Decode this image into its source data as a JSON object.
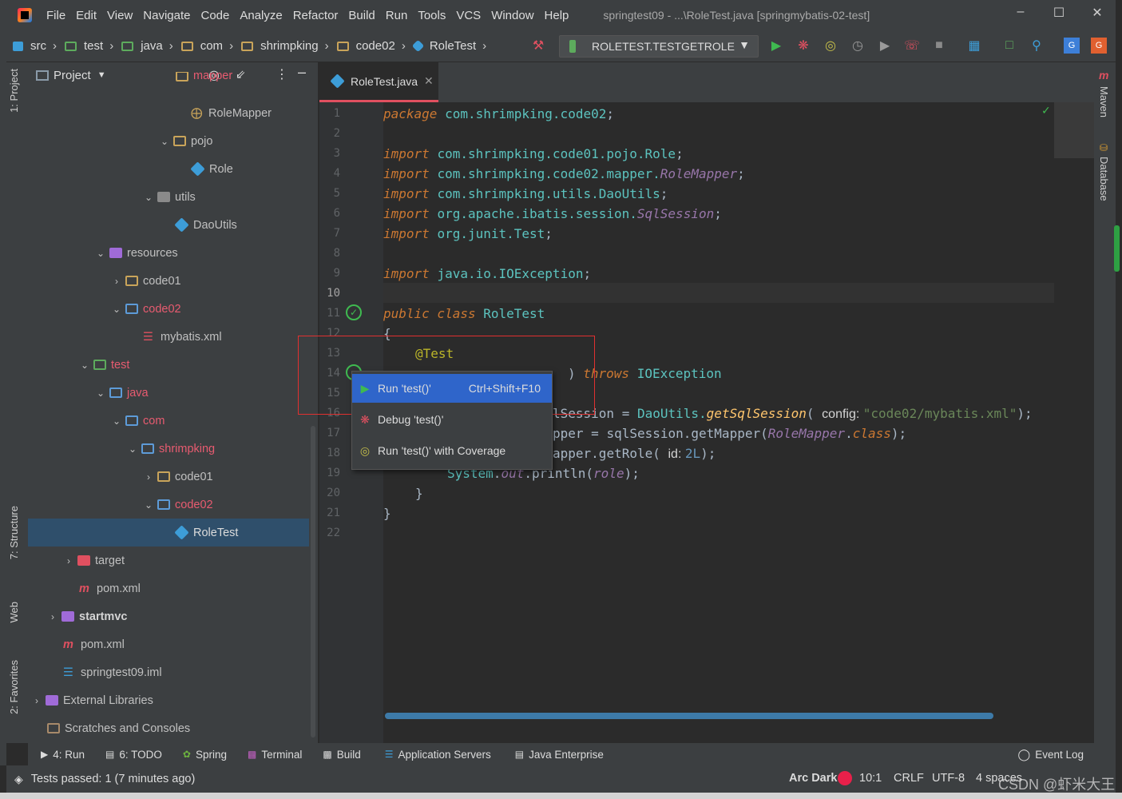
{
  "titlebar": {
    "menus": [
      "File",
      "Edit",
      "View",
      "Navigate",
      "Code",
      "Analyze",
      "Refactor",
      "Build",
      "Run",
      "Tools",
      "VCS",
      "Window",
      "Help"
    ],
    "title": "springtest09 - ...\\RoleTest.java [springmybatis-02-test]"
  },
  "breadcrumbs": [
    "src",
    "test",
    "java",
    "com",
    "shrimpking",
    "code02",
    "RoleTest"
  ],
  "run_config": "ROLETEST.TESTGETROLE",
  "project_panel": {
    "title": "Project",
    "items": [
      {
        "label": "mapper"
      },
      {
        "label": "RoleMapper"
      },
      {
        "label": "pojo"
      },
      {
        "label": "Role"
      },
      {
        "label": "utils"
      },
      {
        "label": "DaoUtils"
      },
      {
        "label": "resources"
      },
      {
        "label": "code01"
      },
      {
        "label": "code02"
      },
      {
        "label": "mybatis.xml"
      },
      {
        "label": "test"
      },
      {
        "label": "java"
      },
      {
        "label": "com"
      },
      {
        "label": "shrimpking"
      },
      {
        "label": "code01"
      },
      {
        "label": "code02"
      },
      {
        "label": "RoleTest"
      },
      {
        "label": "target"
      },
      {
        "label": "pom.xml"
      },
      {
        "label": "startmvc"
      },
      {
        "label": "pom.xml"
      },
      {
        "label": "springtest09.iml"
      },
      {
        "label": "External Libraries"
      },
      {
        "label": "Scratches and Consoles"
      }
    ]
  },
  "left_strip": {
    "project": "1: Project",
    "structure": "7: Structure",
    "web": "Web",
    "favorites": "2: Favorites"
  },
  "right_strip": {
    "maven": "Maven",
    "database": "Database"
  },
  "editor": {
    "tab": "RoleTest.java",
    "line_numbers": [
      "1",
      "2",
      "3",
      "4",
      "5",
      "6",
      "7",
      "8",
      "9",
      "10",
      "11",
      "12",
      "13",
      "14",
      "15",
      "16",
      "17",
      "18",
      "19",
      "20",
      "21",
      "22"
    ]
  },
  "code": {
    "l1a": "package ",
    "l1b": "com.shrimpking.code02",
    "l1c": ";",
    "l3a": "import ",
    "l3b": "com.shrimpking.code01.pojo.Role",
    "l3c": ";",
    "l4a": "import ",
    "l4b": "com.shrimpking.code02.mapper.",
    "l4c": "RoleMapper",
    "l4d": ";",
    "l5a": "import ",
    "l5b": "com.shrimpking.utils.DaoUtils",
    "l5c": ";",
    "l6a": "import ",
    "l6b": "org.apache.ibatis.session.",
    "l6c": "SqlSession",
    "l6d": ";",
    "l7a": "import ",
    "l7b": "org.junit.Test",
    "l7c": ";",
    "l9a": "import ",
    "l9b": "java.io.IOException",
    "l9c": ";",
    "l11a": "public class ",
    "l11b": "RoleTest",
    "l12": "{",
    "l13": "@Test",
    "l14a": "throws ",
    "l14b": "IOException",
    "l16a": "lSession",
    "l16b": " = ",
    "l16c": "DaoUtils.",
    "l16d": "getSqlSession",
    "l16e": "( ",
    "l16f": "config: ",
    "l16g": "\"code02/mybatis.xml\"",
    "l16h": ");",
    "l17a": "pper",
    "l17b": " = ",
    "l17c": "sqlSession",
    "l17d": ".getMapper(",
    "l17e": "RoleMapper",
    "l17f": ".",
    "l17g": "class",
    "l17h": ");",
    "l18a": "apper",
    "l18b": ".getRole( ",
    "l18c": "id: ",
    "l18d": "2L",
    "l18e": ");",
    "l19a": "System",
    "l19b": ".",
    "l19c": "out",
    "l19d": ".println(",
    "l19e": "role",
    "l19f": ");",
    "l20": "}",
    "l21": "}"
  },
  "popup": {
    "items": [
      {
        "label": "Run 'test()'",
        "shortcut": "Ctrl+Shift+F10"
      },
      {
        "label": "Debug 'test()'",
        "shortcut": ""
      },
      {
        "label": "Run 'test()' with Coverage",
        "shortcut": ""
      }
    ]
  },
  "bottom_tools": [
    "4: Run",
    "6: TODO",
    "Spring",
    "Terminal",
    "Build",
    "Application Servers",
    "Java Enterprise",
    "Event Log"
  ],
  "status": {
    "message": "Tests passed: 1 (7 minutes ago)",
    "theme": "Arc Dark",
    "position": "10:1",
    "line_sep": "CRLF",
    "encoding": "UTF-8",
    "indent": "4 spaces",
    "watermark": "CSDN @虾米大王"
  },
  "colors": {
    "accent": "#e05060",
    "selection": "#2f65ca",
    "success": "#2ea043"
  }
}
